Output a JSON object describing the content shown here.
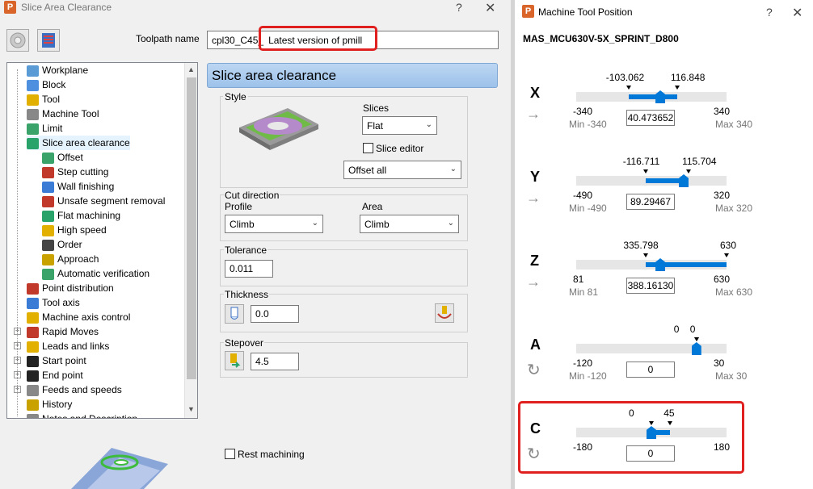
{
  "left_dialog": {
    "title": "Slice Area Clearance",
    "toolpath_name_label": "Toolpath name",
    "toolpath_name_prefix": "cpl30_C45_",
    "toolpath_name_value": "Latest version of pmill",
    "page_title": "Slice area clearance",
    "tree": [
      {
        "label": "Workplane",
        "icon": "workplane-icon",
        "color": "#5b9bd5"
      },
      {
        "label": "Block",
        "icon": "block-icon",
        "color": "#4f8fe0"
      },
      {
        "label": "Tool",
        "icon": "tool-icon",
        "color": "#e2b000"
      },
      {
        "label": "Machine Tool",
        "icon": "machine-tool-icon",
        "color": "#888888"
      },
      {
        "label": "Limit",
        "icon": "limit-icon",
        "color": "#3aa36a"
      },
      {
        "label": "Slice area clearance",
        "icon": "slice-area-icon",
        "color": "#29a36a"
      },
      {
        "label": "Offset",
        "icon": "offset-icon",
        "color": "#3aa36a"
      },
      {
        "label": "Step cutting",
        "icon": "step-cutting-icon",
        "color": "#c0392b"
      },
      {
        "label": "Wall finishing",
        "icon": "wall-finishing-icon",
        "color": "#3a7bd5"
      },
      {
        "label": "Unsafe segment removal",
        "icon": "unsafe-segment-icon",
        "color": "#c0392b"
      },
      {
        "label": "Flat machining",
        "icon": "flat-machining-icon",
        "color": "#29a36a"
      },
      {
        "label": "High speed",
        "icon": "high-speed-icon",
        "color": "#e2b000"
      },
      {
        "label": "Order",
        "icon": "order-icon",
        "color": "#444444"
      },
      {
        "label": "Approach",
        "icon": "approach-icon",
        "color": "#c9a200"
      },
      {
        "label": "Automatic verification",
        "icon": "verification-icon",
        "color": "#3aa36a"
      },
      {
        "label": "Point distribution",
        "icon": "point-distribution-icon",
        "color": "#c0392b"
      },
      {
        "label": "Tool axis",
        "icon": "tool-axis-icon",
        "color": "#3a7bd5"
      },
      {
        "label": "Machine axis control",
        "icon": "machine-axis-icon",
        "color": "#e2b000"
      },
      {
        "label": "Rapid Moves",
        "icon": "rapid-moves-icon",
        "color": "#c0392b"
      },
      {
        "label": "Leads and links",
        "icon": "leads-links-icon",
        "color": "#e2b000"
      },
      {
        "label": "Start point",
        "icon": "start-point-icon",
        "color": "#222222"
      },
      {
        "label": "End point",
        "icon": "end-point-icon",
        "color": "#222222"
      },
      {
        "label": "Feeds and speeds",
        "icon": "feeds-speeds-icon",
        "color": "#888888"
      },
      {
        "label": "History",
        "icon": "history-icon",
        "color": "#c9a200"
      },
      {
        "label": "Notes and Description",
        "icon": "notes-icon",
        "color": "#888888"
      }
    ],
    "style": {
      "label": "Style",
      "slices_label": "Slices",
      "slices_value": "Flat",
      "slice_editor_label": "Slice editor",
      "style_value": "Offset all"
    },
    "cut_direction": {
      "label": "Cut direction",
      "profile_label": "Profile",
      "profile_value": "Climb",
      "area_label": "Area",
      "area_value": "Climb"
    },
    "tolerance": {
      "label": "Tolerance",
      "value": "0.011"
    },
    "thickness": {
      "label": "Thickness",
      "value": "0.0"
    },
    "stepover": {
      "label": "Stepover",
      "value": "4.5"
    },
    "rest_machining_label": "Rest machining"
  },
  "right_panel": {
    "title": "Machine Tool Position",
    "machine_name": "MAS_MCU630V-5X_SPRINT_D800",
    "axes": [
      {
        "letter": "X",
        "marker_left": "-103.062",
        "marker_right": "116.848",
        "min": "-340",
        "max": "340",
        "min_label": "Min -340",
        "max_label": "Max 340",
        "value": "40.473652",
        "icon": "linear-arrow-icon",
        "range": [
          -340,
          340
        ],
        "current": 40.473652,
        "lim": [
          -103.062,
          116.848
        ]
      },
      {
        "letter": "Y",
        "marker_left": "-116.711",
        "marker_right": "115.704",
        "min": "-490",
        "max": "320",
        "min_label": "Min -490",
        "max_label": "Max 320",
        "value": "89.29467",
        "icon": "linear-arrow-icon",
        "range": [
          -490,
          320
        ],
        "current": 89.29467,
        "lim": [
          -116.711,
          115.704
        ]
      },
      {
        "letter": "Z",
        "marker_left": "335.798",
        "marker_right": "630",
        "min": "81",
        "max": "630",
        "min_label": "Min 81",
        "max_label": "Max 630",
        "value": "388.16130",
        "icon": "linear-arrow-icon",
        "range": [
          81,
          630
        ],
        "current": 388.1613,
        "lim": [
          335.798,
          630
        ]
      },
      {
        "letter": "A",
        "marker_left": "0",
        "marker_right": "0",
        "min": "-120",
        "max": "30",
        "min_label": "Min -120",
        "max_label": "Max 30",
        "value": "0",
        "icon": "rotary-arrow-icon",
        "range": [
          -120,
          30
        ],
        "current": 0,
        "lim": [
          0,
          0
        ]
      },
      {
        "letter": "C",
        "marker_left": "0",
        "marker_right": "45",
        "min": "-180",
        "max": "180",
        "min_label": "",
        "max_label": "",
        "value": "0",
        "icon": "rotary-arrow-icon",
        "range": [
          -180,
          180
        ],
        "current": 0,
        "lim": [
          0,
          45
        ]
      }
    ]
  },
  "colors": {
    "accent": "#0078d7",
    "highlight": "#e01f1f",
    "header": "#bcd6f2"
  }
}
